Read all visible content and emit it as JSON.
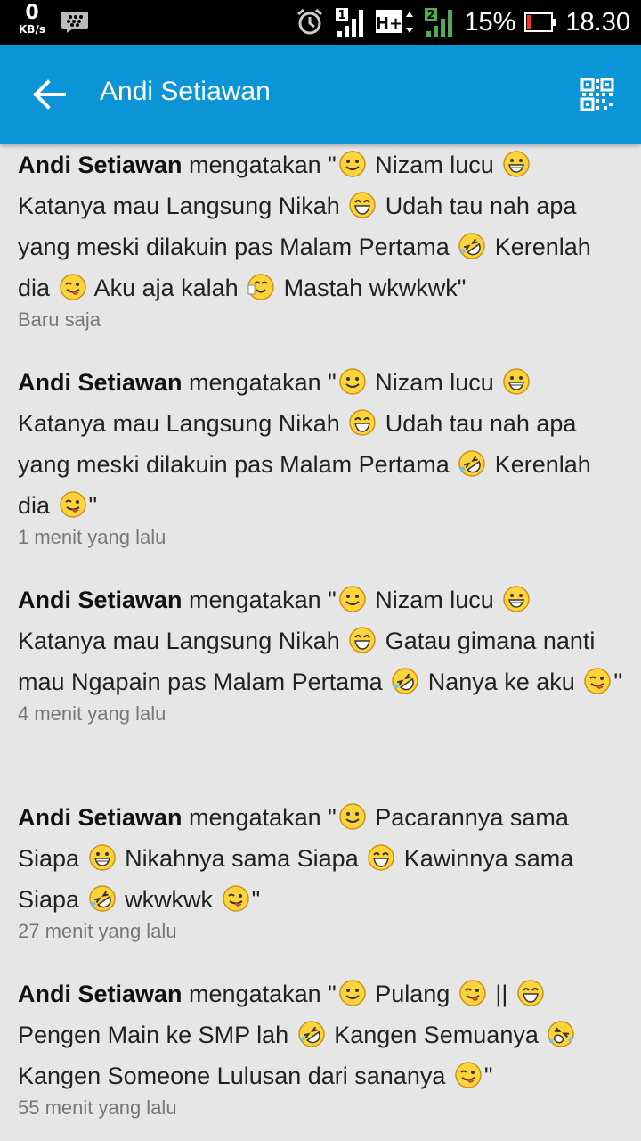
{
  "statusbar": {
    "speed_value": "0",
    "speed_unit": "KB/s",
    "sim1": "1",
    "network_type": "H+",
    "sim2": "2",
    "battery_percent": "15%",
    "time": "18.30"
  },
  "appbar": {
    "title": "Andi Setiawan"
  },
  "posts": [
    {
      "author": "Andi Setiawan",
      "verb": " mengatakan \"",
      "segments": [
        {
          "emoji": "smile"
        },
        {
          "text": " Nizam lucu "
        },
        {
          "emoji": "grin"
        },
        {
          "text": " Katanya mau Langsung Nikah "
        },
        {
          "emoji": "laugh"
        },
        {
          "text": " Udah tau nah apa yang meski dilakuin pas Malam Pertama "
        },
        {
          "emoji": "rofl"
        },
        {
          "text": " Kerenlah dia "
        },
        {
          "emoji": "tongue"
        },
        {
          "text": " Aku aja kalah "
        },
        {
          "emoji": "drink"
        },
        {
          "text": " Mastah wkwkwk\""
        }
      ],
      "time": "Baru saja"
    },
    {
      "author": "Andi Setiawan",
      "verb": " mengatakan \"",
      "segments": [
        {
          "emoji": "smile"
        },
        {
          "text": " Nizam lucu "
        },
        {
          "emoji": "grin"
        },
        {
          "text": " Katanya mau Langsung Nikah "
        },
        {
          "emoji": "laugh"
        },
        {
          "text": " Udah tau nah apa yang meski dilakuin pas Malam Pertama "
        },
        {
          "emoji": "rofl"
        },
        {
          "text": " Kerenlah dia "
        },
        {
          "emoji": "tongue"
        },
        {
          "text": "\""
        }
      ],
      "time": "1 menit yang lalu"
    },
    {
      "author": "Andi Setiawan",
      "verb": " mengatakan \"",
      "segments": [
        {
          "emoji": "smile"
        },
        {
          "text": " Nizam lucu "
        },
        {
          "emoji": "grin"
        },
        {
          "text": " Katanya mau Langsung Nikah "
        },
        {
          "emoji": "laugh"
        },
        {
          "text": " Gatau gimana nanti mau Ngapain pas Malam Pertama "
        },
        {
          "emoji": "rofl"
        },
        {
          "text": " Nanya ke aku "
        },
        {
          "emoji": "tongue"
        },
        {
          "text": "\""
        }
      ],
      "time": "4 menit yang lalu"
    },
    {
      "author": "Andi Setiawan",
      "verb": " mengatakan \"",
      "segments": [
        {
          "emoji": "smile"
        },
        {
          "text": " Pacarannya sama Siapa "
        },
        {
          "emoji": "grin"
        },
        {
          "text": " Nikahnya sama Siapa "
        },
        {
          "emoji": "laugh"
        },
        {
          "text": " Kawinnya sama Siapa "
        },
        {
          "emoji": "rofl"
        },
        {
          "text": " wkwkwk "
        },
        {
          "emoji": "tongue"
        },
        {
          "text": "\""
        }
      ],
      "time": "27 menit yang lalu"
    },
    {
      "author": "Andi Setiawan",
      "verb": " mengatakan \"",
      "segments": [
        {
          "emoji": "smile"
        },
        {
          "text": " Pulang "
        },
        {
          "emoji": "tongue"
        },
        {
          "text": " || "
        },
        {
          "emoji": "laugh"
        },
        {
          "text": " Pengen Main ke SMP lah "
        },
        {
          "emoji": "rofl"
        },
        {
          "text": " Kangen Semuanya "
        },
        {
          "emoji": "teary"
        },
        {
          "text": " Kangen Someone Lulusan dari sananya "
        },
        {
          "emoji": "tongue"
        },
        {
          "text": "\""
        }
      ],
      "time": "55 menit yang lalu"
    }
  ]
}
